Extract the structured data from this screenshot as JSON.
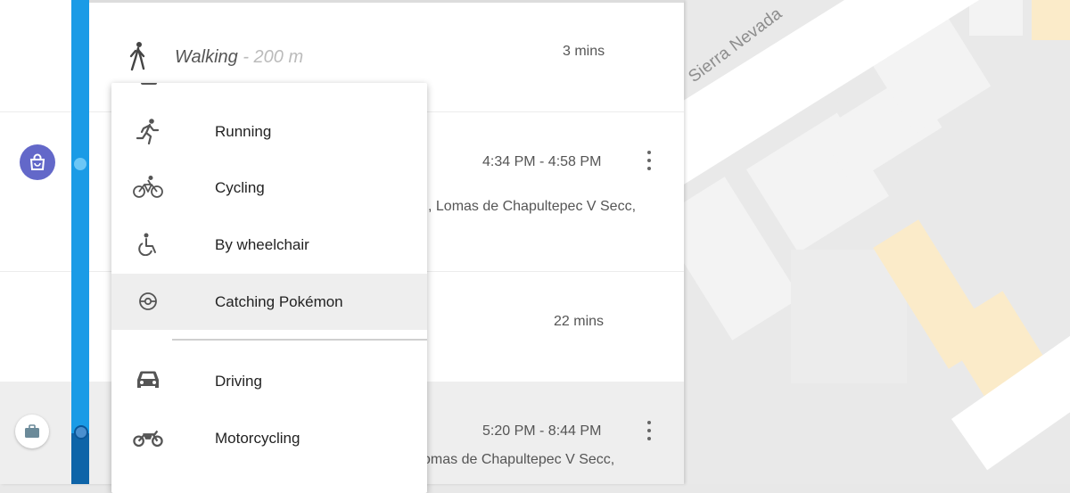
{
  "map": {
    "street_label": "Sierra Nevada"
  },
  "timeline": {
    "walking": {
      "mode": "Walking",
      "distance": "- 200 m",
      "duration": "3 mins"
    },
    "stop1": {
      "time_range": "4:34 PM - 4:58 PM",
      "address": ", Lomas de Chapultepec V Secc,"
    },
    "travel2": {
      "duration": "22 mins"
    },
    "stop2": {
      "time_range": "5:20 PM - 8:44 PM",
      "address": "omas de Chapultepec V Secc,"
    }
  },
  "menu": {
    "items": [
      {
        "label": "Running",
        "icon": "running-icon"
      },
      {
        "label": "Cycling",
        "icon": "bicycle-icon"
      },
      {
        "label": "By wheelchair",
        "icon": "wheelchair-icon"
      },
      {
        "label": "Catching Pokémon",
        "icon": "pokeball-icon",
        "selected": true
      },
      {
        "label": "Driving",
        "icon": "car-icon"
      },
      {
        "label": "Motorcycling",
        "icon": "motorcycle-icon"
      }
    ]
  },
  "colors": {
    "rail": "#1a9be6",
    "rail_dark": "#0e64a8",
    "place_icon_bg": "#6368c9",
    "selected_bg": "#eeeeee"
  }
}
